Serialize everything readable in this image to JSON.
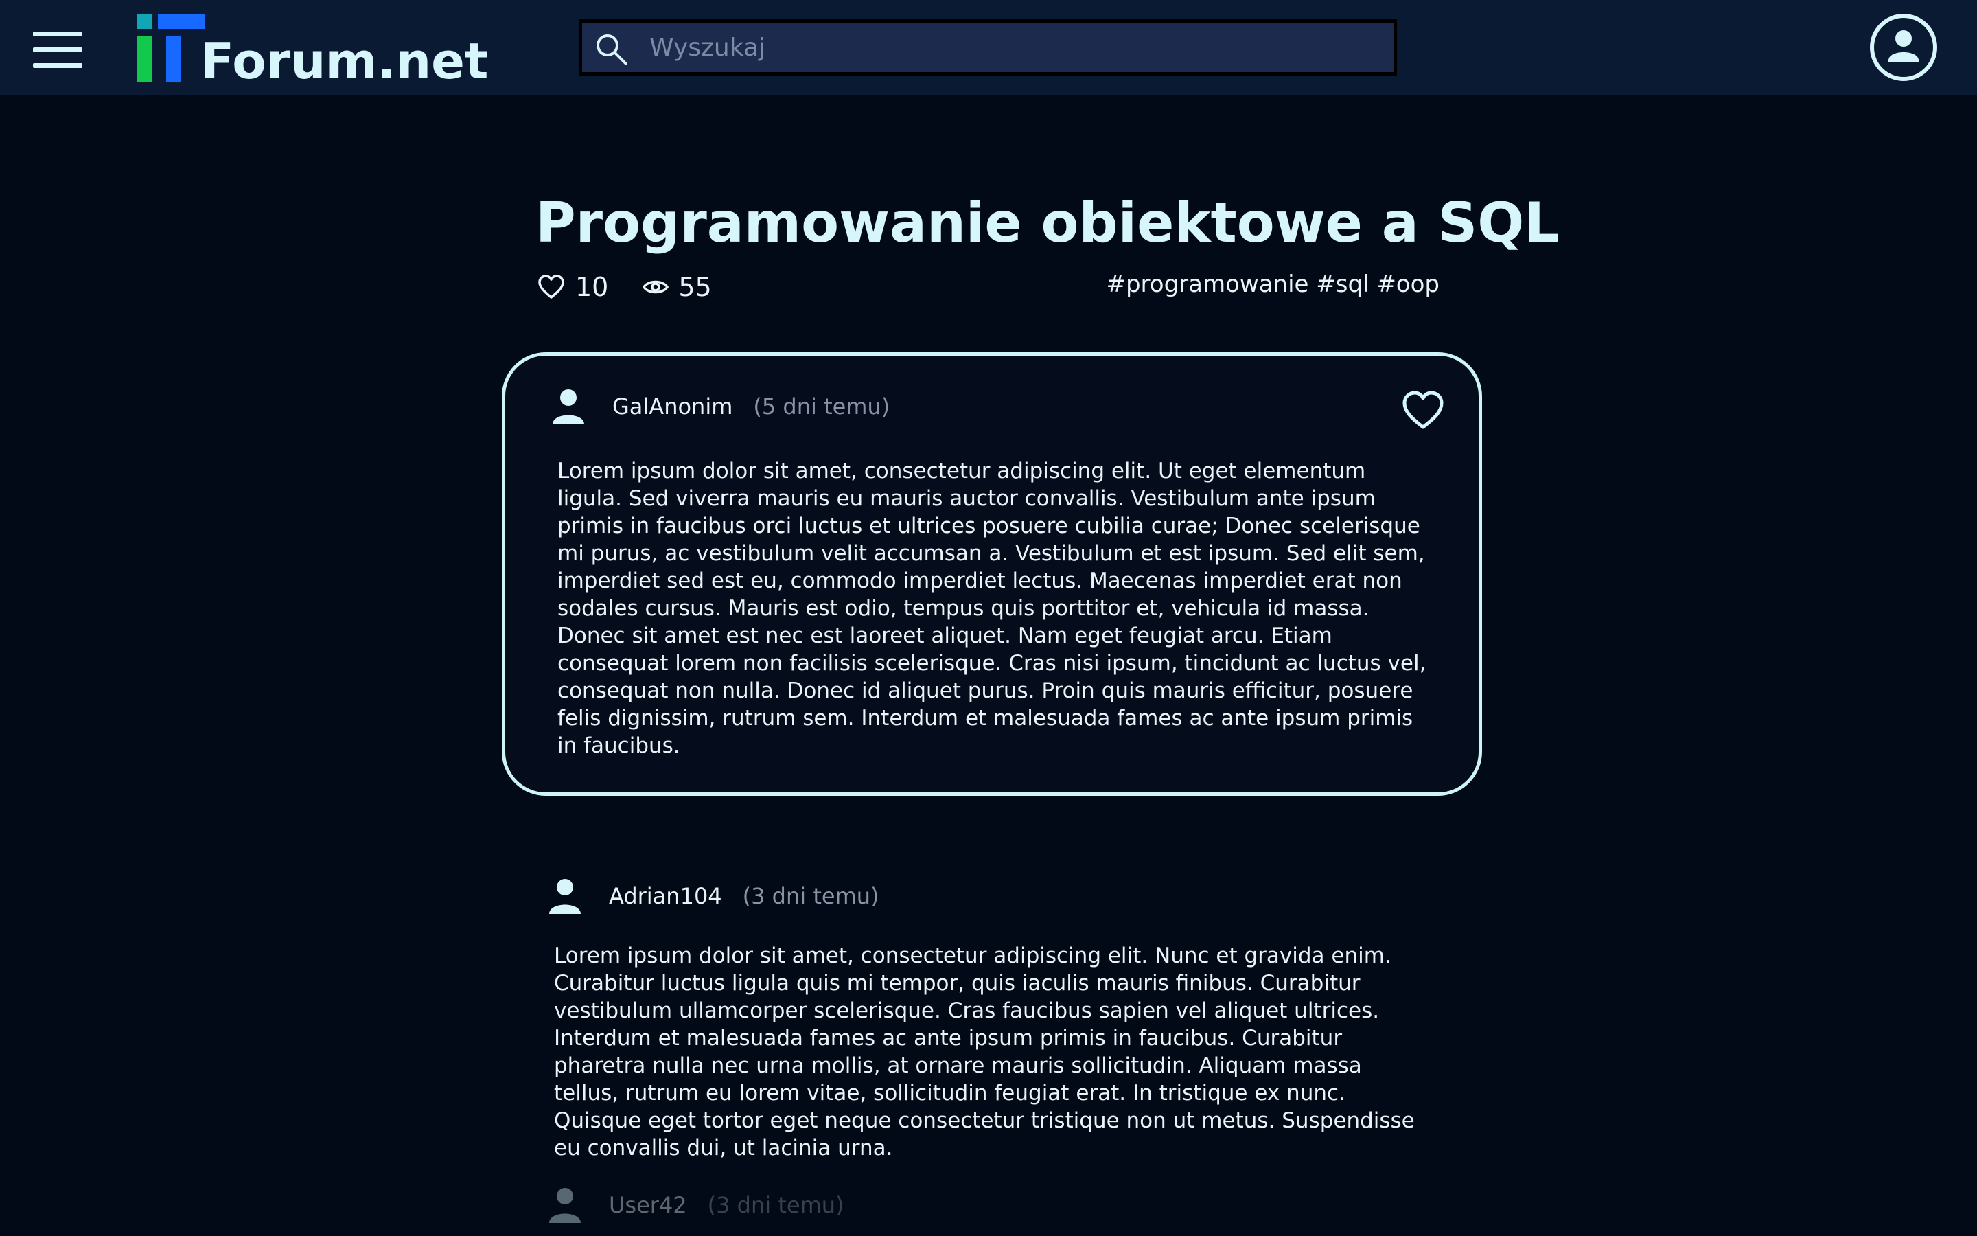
{
  "header": {
    "logo_text": "Forum.net",
    "search_placeholder": "Wyszukaj",
    "search_value": "",
    "menu_icon": "hamburger-icon",
    "profile_icon": "user-circle-icon"
  },
  "thread": {
    "title": "Programowanie obiektowe a SQL",
    "likes": "10",
    "views": "55",
    "tags": [
      "#programowanie",
      "#sql",
      "#oop"
    ]
  },
  "posts": [
    {
      "author": "GalAnonim",
      "time": "(5 dni temu)",
      "body": "Lorem ipsum dolor sit amet, consectetur adipiscing elit. Ut eget elementum ligula. Sed viverra mauris eu mauris auctor convallis. Vestibulum ante ipsum primis in faucibus orci luctus et ultrices posuere cubilia curae; Donec scelerisque mi purus, ac vestibulum velit accumsan a. Vestibulum et est ipsum. Sed elit sem, imperdiet sed est eu, commodo imperdiet lectus. Maecenas imperdiet erat non sodales cursus. Mauris est odio, tempus quis porttitor et, vehicula id massa. Donec sit amet est nec est laoreet aliquet. Nam eget feugiat arcu. Etiam consequat lorem non facilisis scelerisque. Cras nisi ipsum, tincidunt ac luctus vel, consequat non nulla. Donec id aliquet purus. Proin quis mauris efficitur, posuere felis dignissim, rutrum sem. Interdum et malesuada fames ac ante ipsum primis in faucibus."
    },
    {
      "author": "Adrian104",
      "time": "(3 dni temu)",
      "body": "Lorem ipsum dolor sit amet, consectetur adipiscing elit. Nunc et gravida enim. Curabitur luctus ligula quis mi tempor, quis iaculis mauris finibus. Curabitur vestibulum ullamcorper scelerisque. Cras faucibus sapien vel aliquet ultrices. Interdum et malesuada fames ac ante ipsum primis in faucibus. Curabitur pharetra nulla nec urna mollis, at ornare mauris sollicitudin. Aliquam massa tellus, rutrum eu lorem vitae, sollicitudin feugiat erat. In tristique ex nunc. Quisque eget tortor eget neque consectetur tristique non ut metus. Suspendisse eu convallis dui, ut lacinia urna."
    },
    {
      "author": "User42",
      "time": "(3 dni temu)"
    }
  ],
  "colors": {
    "background": "#030a17",
    "topbar": "#0b1a33",
    "accent_light": "#d6f6fb",
    "logo_teal": "#10a6b4",
    "logo_blue": "#1769ff",
    "logo_green": "#12c94e",
    "muted_text": "#8a93a6"
  },
  "icons": {
    "likes": "heart-outline-icon",
    "views": "eye-icon",
    "author": "user-icon",
    "post_like": "heart-outline-icon"
  }
}
